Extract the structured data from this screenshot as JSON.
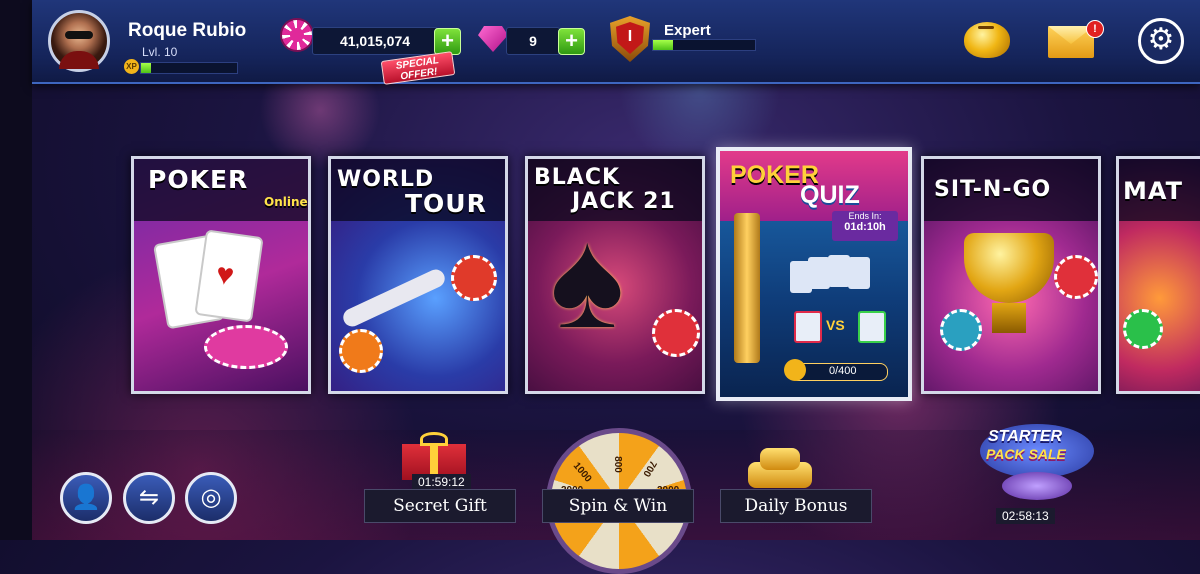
{
  "player": {
    "name": "Roque Rubio",
    "level": "Lvl. 10",
    "xp_badge": "XP",
    "xp_progress": 0.1
  },
  "currency": {
    "chips": "41,015,074",
    "special_offer": "SPECIAL OFFER!",
    "gems": "9",
    "plus": "+"
  },
  "rank": {
    "name": "Expert",
    "badge": "I",
    "progress": 0.2
  },
  "top_icons": {
    "mail_badge": "!",
    "settings_icon": "gear-icon",
    "piggy_icon": "piggy-bank-icon",
    "mail_icon": "mail-icon"
  },
  "games": [
    {
      "title_line1": "POKER",
      "subtitle": "Online"
    },
    {
      "title_line1": "WORLD",
      "title_line2": "TOUR"
    },
    {
      "title_line1": "BLACK",
      "title_line2": "JACK 21"
    },
    {
      "title_line1": "POKER",
      "title_line2": "QUIZ",
      "ends_label": "Ends In:",
      "ends_time": "01d:10h",
      "progress_text": "0/400",
      "vs": "VS"
    },
    {
      "title_line1": "SIT-N-GO"
    },
    {
      "title_line1": "MAT"
    }
  ],
  "bottom": {
    "secret_gift": {
      "label": "Secret Gift",
      "timer": "01:59:12"
    },
    "spin_win": {
      "label": "Spin & Win",
      "wheel_values": [
        "800",
        "1000",
        "2000",
        "700",
        "2000"
      ]
    },
    "daily_bonus": {
      "label": "Daily Bonus"
    },
    "starter_pack": {
      "line1": "STARTER",
      "line2": "PACK SALE",
      "timer": "02:58:13"
    }
  },
  "colors": {
    "accent_green": "#4fc218",
    "topbar": "#15245a",
    "badge_red": "#e12020"
  }
}
